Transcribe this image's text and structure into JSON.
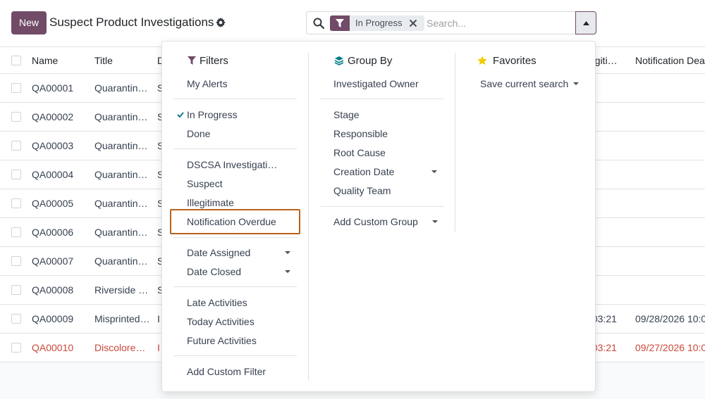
{
  "header": {
    "new_label": "New",
    "title": "Suspect Product Investigations"
  },
  "search": {
    "facet_label": "In Progress",
    "placeholder": "Search..."
  },
  "table": {
    "columns": [
      "Name",
      "Title",
      "D",
      "egiti…",
      "Notification Dea"
    ],
    "rows": [
      {
        "name": "QA00001",
        "title": "Quarantin…",
        "d": "S",
        "leg": "",
        "notif": ""
      },
      {
        "name": "QA00002",
        "title": "Quarantin…",
        "d": "S",
        "leg": "",
        "notif": ""
      },
      {
        "name": "QA00003",
        "title": "Quarantin…",
        "d": "S",
        "leg": "",
        "notif": ""
      },
      {
        "name": "QA00004",
        "title": "Quarantin…",
        "d": "S",
        "leg": "",
        "notif": ""
      },
      {
        "name": "QA00005",
        "title": "Quarantin…",
        "d": "S",
        "leg": "",
        "notif": ""
      },
      {
        "name": "QA00006",
        "title": "Quarantin…",
        "d": "S",
        "leg": "",
        "notif": ""
      },
      {
        "name": "QA00007",
        "title": "Quarantin…",
        "d": "S",
        "leg": "",
        "notif": ""
      },
      {
        "name": "QA00008",
        "title": "Riverside …",
        "d": "S",
        "leg": "",
        "notif": ""
      },
      {
        "name": "QA00009",
        "title": "Misprinted…",
        "d": "I",
        "leg": ":03:21",
        "notif": "09/28/2026 10:0"
      },
      {
        "name": "QA00010",
        "title": "Discolore…",
        "d": "I",
        "leg": ":03:21",
        "notif": "09/27/2026 10:0"
      }
    ]
  },
  "filters": {
    "heading": "Filters",
    "my_alerts": "My Alerts",
    "in_progress": "In Progress",
    "done": "Done",
    "dscsa": "DSCSA Investigati…",
    "suspect": "Suspect",
    "illegitimate": "Illegitimate",
    "notification_overdue": "Notification Overdue",
    "date_assigned": "Date Assigned",
    "date_closed": "Date Closed",
    "late_activities": "Late Activities",
    "today_activities": "Today Activities",
    "future_activities": "Future Activities",
    "add_custom_filter": "Add Custom Filter"
  },
  "groupby": {
    "heading": "Group By",
    "investigated_owner": "Investigated Owner",
    "stage": "Stage",
    "responsible": "Responsible",
    "root_cause": "Root Cause",
    "creation_date": "Creation Date",
    "quality_team": "Quality Team",
    "add_custom_group": "Add Custom Group"
  },
  "favorites": {
    "heading": "Favorites",
    "save_current_search": "Save current search"
  },
  "colors": {
    "brand": "#714b67",
    "filter_icon": "#714b67",
    "groupby_icon": "#017e84",
    "favorites_icon": "#f3cc00",
    "overdue_row": "#c9493a",
    "highlight": "#b8621b"
  }
}
